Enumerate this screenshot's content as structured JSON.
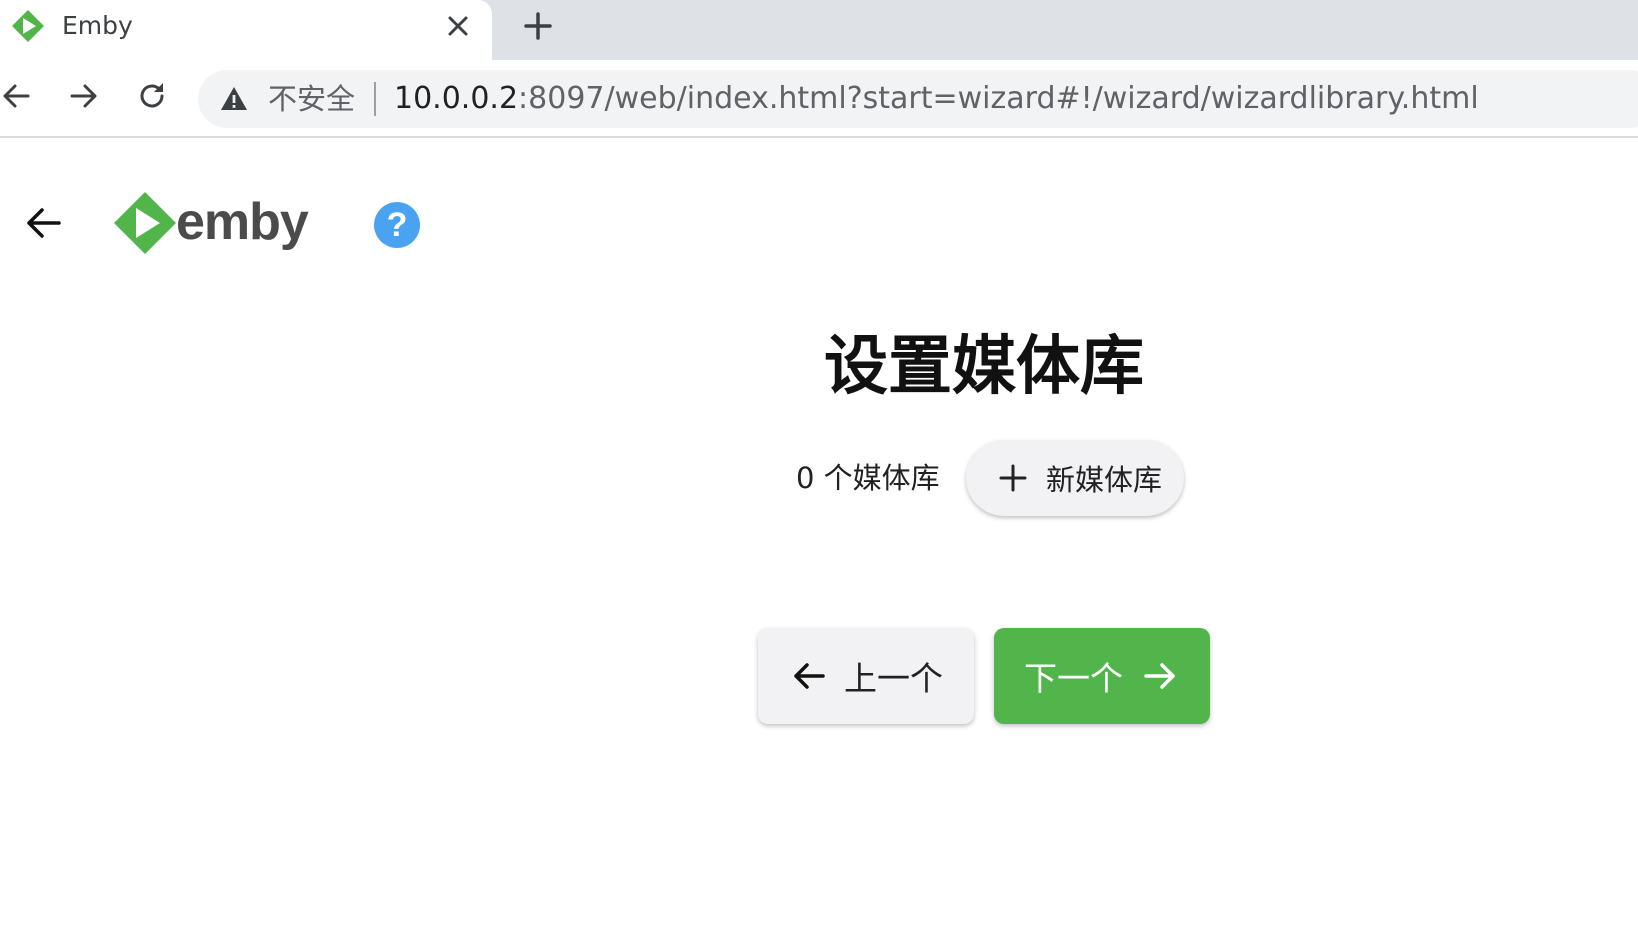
{
  "browser": {
    "tab": {
      "title": "Emby"
    },
    "omnibox": {
      "security_label": "不安全",
      "url_host": "10.0.0.2",
      "url_rest": ":8097/web/index.html?start=wizard#!/wizard/wizardlibrary.html"
    }
  },
  "header": {
    "logo_text": "emby",
    "help_symbol": "?"
  },
  "main": {
    "title": "设置媒体库",
    "library_count_label": "0 个媒体库",
    "new_library_label": "新媒体库",
    "prev_label": "上一个",
    "next_label": "下一个"
  },
  "colors": {
    "brand_green": "#52b54b",
    "help_blue": "#4aa3f0"
  },
  "icons": {
    "tab_favicon": "emby-logo-icon",
    "tab_close": "close-icon",
    "new_tab": "plus-icon",
    "back": "arrow-left-icon",
    "forward": "arrow-right-icon",
    "reload": "reload-icon",
    "security": "warning-triangle-icon",
    "help": "help-circle-icon"
  }
}
